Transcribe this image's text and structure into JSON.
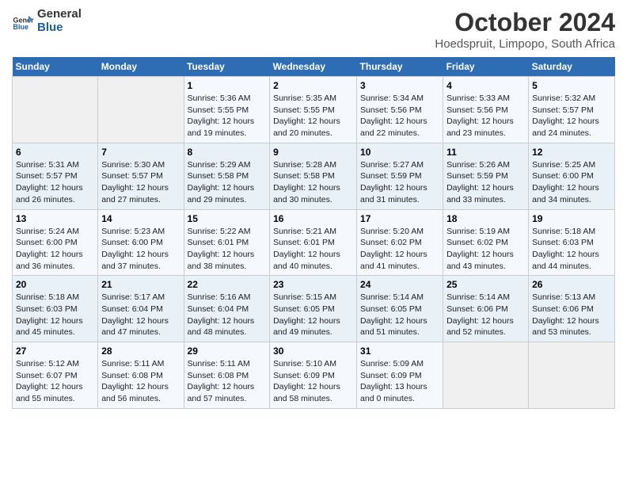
{
  "logo": {
    "line1": "General",
    "line2": "Blue"
  },
  "title": "October 2024",
  "subtitle": "Hoedspruit, Limpopo, South Africa",
  "days_of_week": [
    "Sunday",
    "Monday",
    "Tuesday",
    "Wednesday",
    "Thursday",
    "Friday",
    "Saturday"
  ],
  "weeks": [
    [
      {
        "day": "",
        "info": ""
      },
      {
        "day": "",
        "info": ""
      },
      {
        "day": "1",
        "info": "Sunrise: 5:36 AM\nSunset: 5:55 PM\nDaylight: 12 hours and 19 minutes."
      },
      {
        "day": "2",
        "info": "Sunrise: 5:35 AM\nSunset: 5:55 PM\nDaylight: 12 hours and 20 minutes."
      },
      {
        "day": "3",
        "info": "Sunrise: 5:34 AM\nSunset: 5:56 PM\nDaylight: 12 hours and 22 minutes."
      },
      {
        "day": "4",
        "info": "Sunrise: 5:33 AM\nSunset: 5:56 PM\nDaylight: 12 hours and 23 minutes."
      },
      {
        "day": "5",
        "info": "Sunrise: 5:32 AM\nSunset: 5:57 PM\nDaylight: 12 hours and 24 minutes."
      }
    ],
    [
      {
        "day": "6",
        "info": "Sunrise: 5:31 AM\nSunset: 5:57 PM\nDaylight: 12 hours and 26 minutes."
      },
      {
        "day": "7",
        "info": "Sunrise: 5:30 AM\nSunset: 5:57 PM\nDaylight: 12 hours and 27 minutes."
      },
      {
        "day": "8",
        "info": "Sunrise: 5:29 AM\nSunset: 5:58 PM\nDaylight: 12 hours and 29 minutes."
      },
      {
        "day": "9",
        "info": "Sunrise: 5:28 AM\nSunset: 5:58 PM\nDaylight: 12 hours and 30 minutes."
      },
      {
        "day": "10",
        "info": "Sunrise: 5:27 AM\nSunset: 5:59 PM\nDaylight: 12 hours and 31 minutes."
      },
      {
        "day": "11",
        "info": "Sunrise: 5:26 AM\nSunset: 5:59 PM\nDaylight: 12 hours and 33 minutes."
      },
      {
        "day": "12",
        "info": "Sunrise: 5:25 AM\nSunset: 6:00 PM\nDaylight: 12 hours and 34 minutes."
      }
    ],
    [
      {
        "day": "13",
        "info": "Sunrise: 5:24 AM\nSunset: 6:00 PM\nDaylight: 12 hours and 36 minutes."
      },
      {
        "day": "14",
        "info": "Sunrise: 5:23 AM\nSunset: 6:00 PM\nDaylight: 12 hours and 37 minutes."
      },
      {
        "day": "15",
        "info": "Sunrise: 5:22 AM\nSunset: 6:01 PM\nDaylight: 12 hours and 38 minutes."
      },
      {
        "day": "16",
        "info": "Sunrise: 5:21 AM\nSunset: 6:01 PM\nDaylight: 12 hours and 40 minutes."
      },
      {
        "day": "17",
        "info": "Sunrise: 5:20 AM\nSunset: 6:02 PM\nDaylight: 12 hours and 41 minutes."
      },
      {
        "day": "18",
        "info": "Sunrise: 5:19 AM\nSunset: 6:02 PM\nDaylight: 12 hours and 43 minutes."
      },
      {
        "day": "19",
        "info": "Sunrise: 5:18 AM\nSunset: 6:03 PM\nDaylight: 12 hours and 44 minutes."
      }
    ],
    [
      {
        "day": "20",
        "info": "Sunrise: 5:18 AM\nSunset: 6:03 PM\nDaylight: 12 hours and 45 minutes."
      },
      {
        "day": "21",
        "info": "Sunrise: 5:17 AM\nSunset: 6:04 PM\nDaylight: 12 hours and 47 minutes."
      },
      {
        "day": "22",
        "info": "Sunrise: 5:16 AM\nSunset: 6:04 PM\nDaylight: 12 hours and 48 minutes."
      },
      {
        "day": "23",
        "info": "Sunrise: 5:15 AM\nSunset: 6:05 PM\nDaylight: 12 hours and 49 minutes."
      },
      {
        "day": "24",
        "info": "Sunrise: 5:14 AM\nSunset: 6:05 PM\nDaylight: 12 hours and 51 minutes."
      },
      {
        "day": "25",
        "info": "Sunrise: 5:14 AM\nSunset: 6:06 PM\nDaylight: 12 hours and 52 minutes."
      },
      {
        "day": "26",
        "info": "Sunrise: 5:13 AM\nSunset: 6:06 PM\nDaylight: 12 hours and 53 minutes."
      }
    ],
    [
      {
        "day": "27",
        "info": "Sunrise: 5:12 AM\nSunset: 6:07 PM\nDaylight: 12 hours and 55 minutes."
      },
      {
        "day": "28",
        "info": "Sunrise: 5:11 AM\nSunset: 6:08 PM\nDaylight: 12 hours and 56 minutes."
      },
      {
        "day": "29",
        "info": "Sunrise: 5:11 AM\nSunset: 6:08 PM\nDaylight: 12 hours and 57 minutes."
      },
      {
        "day": "30",
        "info": "Sunrise: 5:10 AM\nSunset: 6:09 PM\nDaylight: 12 hours and 58 minutes."
      },
      {
        "day": "31",
        "info": "Sunrise: 5:09 AM\nSunset: 6:09 PM\nDaylight: 13 hours and 0 minutes."
      },
      {
        "day": "",
        "info": ""
      },
      {
        "day": "",
        "info": ""
      }
    ]
  ]
}
